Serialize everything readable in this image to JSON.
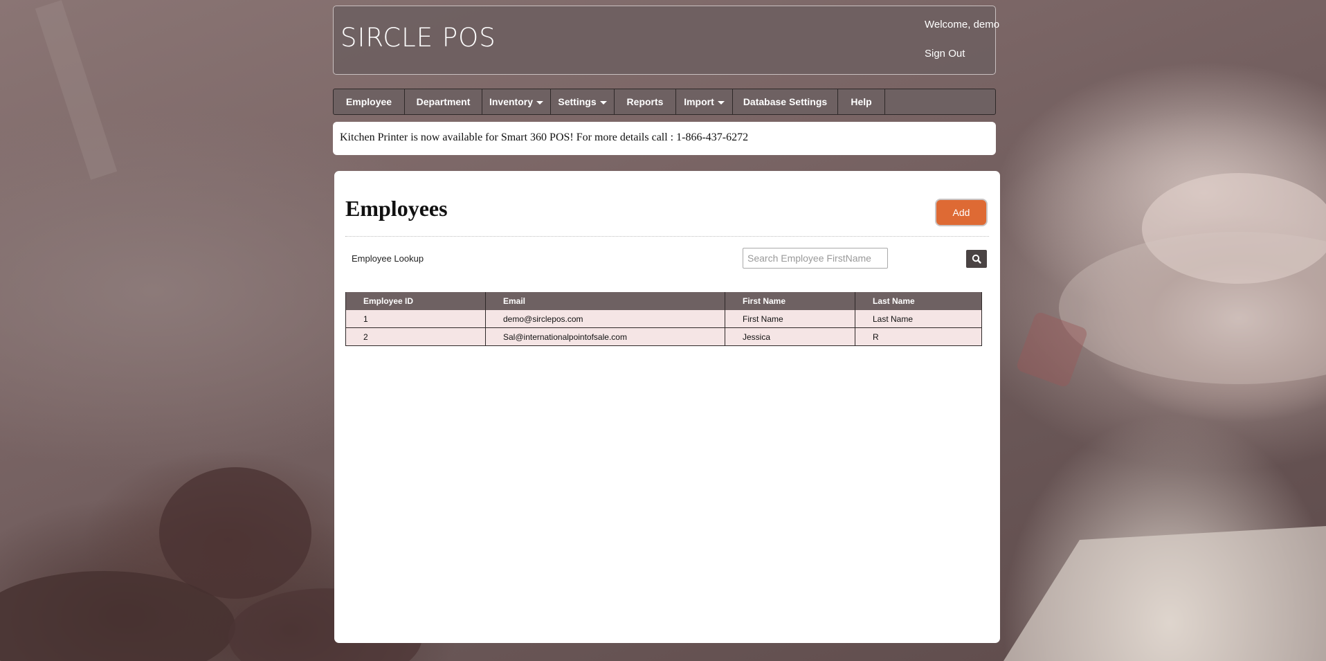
{
  "header": {
    "logo_text": "SIRCLE POS",
    "welcome_text": "Welcome, demo",
    "signout_label": "Sign Out"
  },
  "nav": {
    "items": [
      {
        "label": "Employee",
        "has_dropdown": false
      },
      {
        "label": "Department",
        "has_dropdown": false
      },
      {
        "label": "Inventory",
        "has_dropdown": true
      },
      {
        "label": "Settings",
        "has_dropdown": true
      },
      {
        "label": "Reports",
        "has_dropdown": false
      },
      {
        "label": "Import",
        "has_dropdown": true
      },
      {
        "label": "Database Settings",
        "has_dropdown": false
      },
      {
        "label": "Help",
        "has_dropdown": false
      }
    ]
  },
  "notice": {
    "text": "Kitchen Printer is now available for Smart 360 POS! For more details call : 1-866-437-6272"
  },
  "main": {
    "title": "Employees",
    "add_label": "Add",
    "lookup_label": "Employee Lookup",
    "search": {
      "placeholder": "Search Employee FirstName",
      "value": ""
    },
    "search_icon": "search-icon",
    "table": {
      "columns": [
        "Employee ID",
        "Email",
        "First Name",
        "Last Name"
      ],
      "rows": [
        [
          "1",
          "demo@sirclepos.com",
          "First Name",
          "Last Name"
        ],
        [
          "2",
          "Sal@internationalpointofsale.com",
          "Jessica",
          "R"
        ]
      ]
    }
  },
  "colors": {
    "accent": "#de6a34",
    "nav_bg": "#6e6162",
    "row_bg": "#f5e5e5"
  }
}
